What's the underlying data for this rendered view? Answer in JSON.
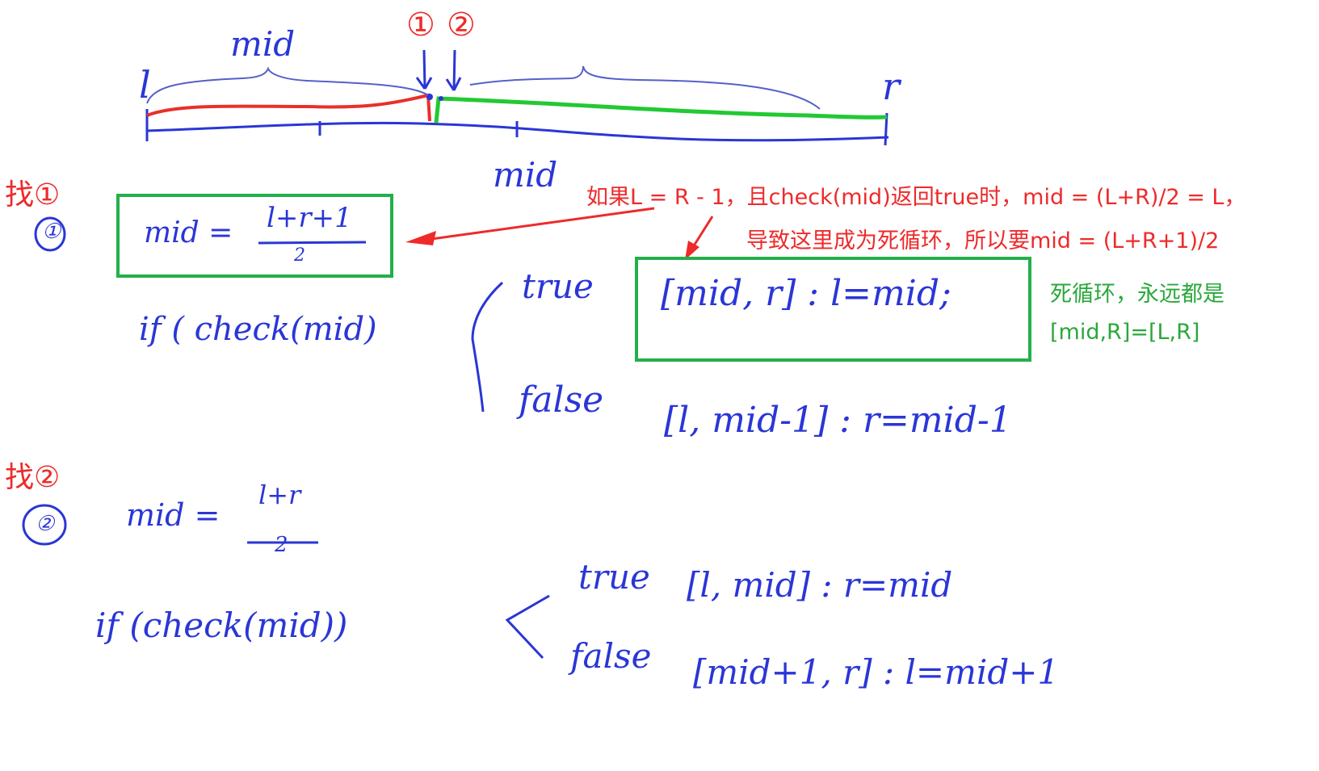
{
  "number_line": {
    "left_label": "l",
    "right_label": "r",
    "brace_label": "mid",
    "marker_1": "①",
    "marker_2": "②",
    "below_label": "mid",
    "colors": {
      "left_segment": "#e8302a",
      "right_segment": "#22c933",
      "axis": "#2a36d6",
      "markers": "#ee2a2a"
    }
  },
  "case1": {
    "heading": "找①",
    "circled": "①",
    "mid_formula_lhs": "mid =",
    "mid_formula_num": "l+r+1",
    "mid_formula_den": "2",
    "condition": "if ( check(mid)",
    "true_label": "true",
    "true_branch": "[mid, r] : l=mid;",
    "false_label": "false",
    "false_branch": "[l, mid-1] : r=mid-1"
  },
  "case2": {
    "heading": "找②",
    "circled": "②",
    "mid_formula_lhs": "mid =",
    "mid_formula_num": "l+r",
    "mid_formula_den": "2",
    "condition": "if (check(mid))",
    "true_label": "true",
    "true_branch": "[l, mid] : r=mid",
    "false_label": "false",
    "false_branch": "[mid+1, r] : l=mid+1"
  },
  "annotations": {
    "red_line1": "如果L = R - 1，且check(mid)返回true时，mid = (L+R)/2 = L，",
    "red_line2": "导致这里成为死循环，所以要mid = (L+R+1)/2",
    "green_line1": "死循环，永远都是",
    "green_line2": "[mid,R]=[L,R]",
    "colors": {
      "red": "#ee2a2a",
      "green": "#2aa83a",
      "box": "#22b04a",
      "ink": "#2a36d6"
    }
  }
}
